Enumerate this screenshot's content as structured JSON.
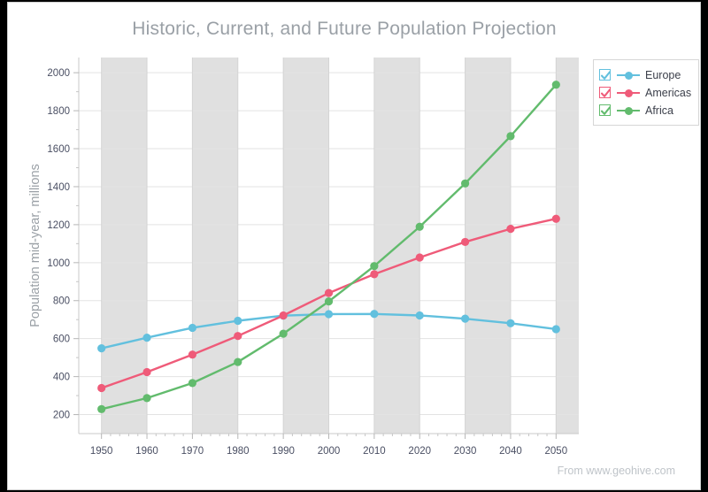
{
  "chart_data": {
    "type": "line",
    "title": "Historic, Current, and Future Population Projection",
    "xlabel": "",
    "ylabel": "Population mid-year, millions",
    "categories": [
      1950,
      1960,
      1970,
      1980,
      1990,
      2000,
      2010,
      2020,
      2030,
      2040,
      2050
    ],
    "x_tick_labels": [
      "1950",
      "1960",
      "1970",
      "1980",
      "1990",
      "2000",
      "2010",
      "2020",
      "2030",
      "2040",
      "2050"
    ],
    "y_tick_labels": [
      "200",
      "400",
      "600",
      "800",
      "1000",
      "1200",
      "1400",
      "1600",
      "1800",
      "2000"
    ],
    "ylim": [
      100,
      2080
    ],
    "xlim": [
      1945,
      2055
    ],
    "y_tick_step": 200,
    "grid": true,
    "alternating_bands": true,
    "legend_position": "right-top",
    "series": [
      {
        "name": "Europe",
        "color": "#62c0de",
        "checked": true,
        "values": [
          549,
          605,
          657,
          694,
          721,
          729,
          730,
          722,
          705,
          681,
          650
        ]
      },
      {
        "name": "Americas",
        "color": "#ef5b79",
        "checked": true,
        "values": [
          340,
          424,
          516,
          614,
          722,
          840,
          939,
          1027,
          1109,
          1178,
          1231
        ]
      },
      {
        "name": "Africa",
        "color": "#62bb6d",
        "checked": true,
        "values": [
          229,
          287,
          366,
          477,
          626,
          796,
          982,
          1189,
          1417,
          1666,
          1937
        ]
      }
    ]
  },
  "legend": {
    "items": [
      {
        "label": "Europe"
      },
      {
        "label": "Americas"
      },
      {
        "label": "Africa"
      }
    ]
  },
  "footer": {
    "source_text": "From www.geohive.com"
  },
  "colors": {
    "europe": "#62c0de",
    "americas": "#ef5b79",
    "africa": "#62bb6d",
    "title": "#9aa0a6",
    "axis_text": "#4a4f63",
    "band": "#e0e0e0",
    "grid": "#e3e3e3"
  }
}
